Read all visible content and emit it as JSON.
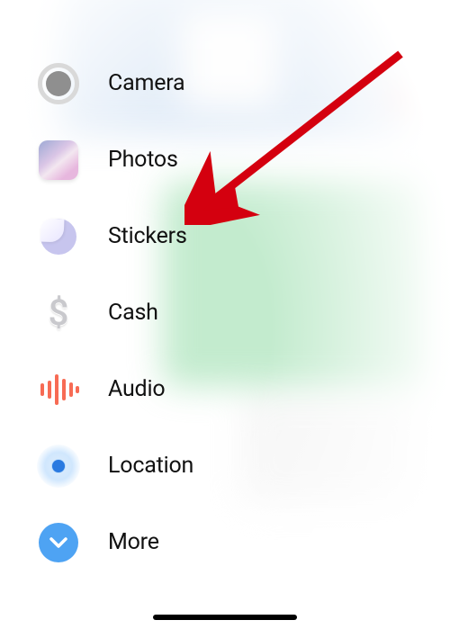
{
  "menu": {
    "items": [
      {
        "label": "Camera"
      },
      {
        "label": "Photos"
      },
      {
        "label": "Stickers"
      },
      {
        "label": "Cash"
      },
      {
        "label": "Audio"
      },
      {
        "label": "Location"
      },
      {
        "label": "More"
      }
    ],
    "cash_glyph": "$"
  },
  "annotation": {
    "target_item": "Stickers"
  }
}
